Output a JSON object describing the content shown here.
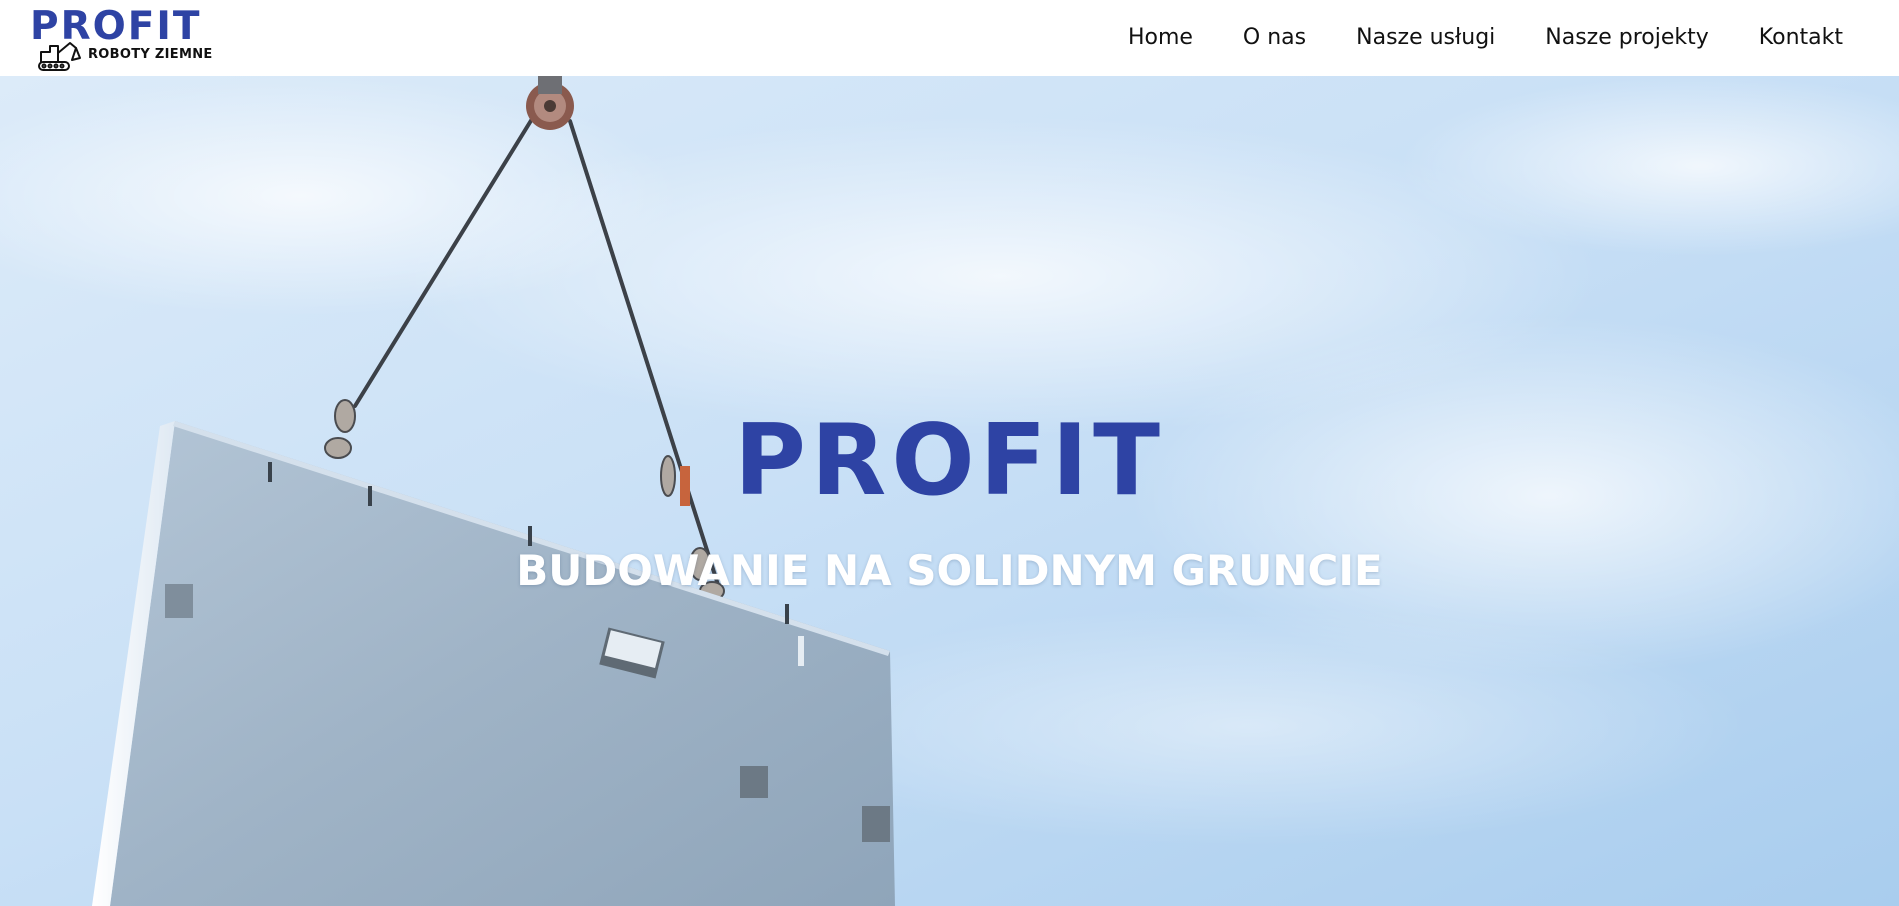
{
  "brand": {
    "name": "PROFIT",
    "tagline": "ROBOTY ZIEMNE",
    "primary_color": "#2e43a4",
    "logo_icon": "excavator-icon"
  },
  "nav": {
    "items": [
      {
        "label": "Home"
      },
      {
        "label": "O nas"
      },
      {
        "label": "Nasze usługi"
      },
      {
        "label": "Nasze projekty"
      },
      {
        "label": "Kontakt"
      }
    ]
  },
  "hero": {
    "title": "PROFIT",
    "subtitle": "BUDOWANIE NA SOLIDNYM GRUNCIE",
    "title_color": "#2e43a4",
    "subtitle_color": "#ffffff",
    "background_image": "crane-lifting-concrete-slab"
  }
}
